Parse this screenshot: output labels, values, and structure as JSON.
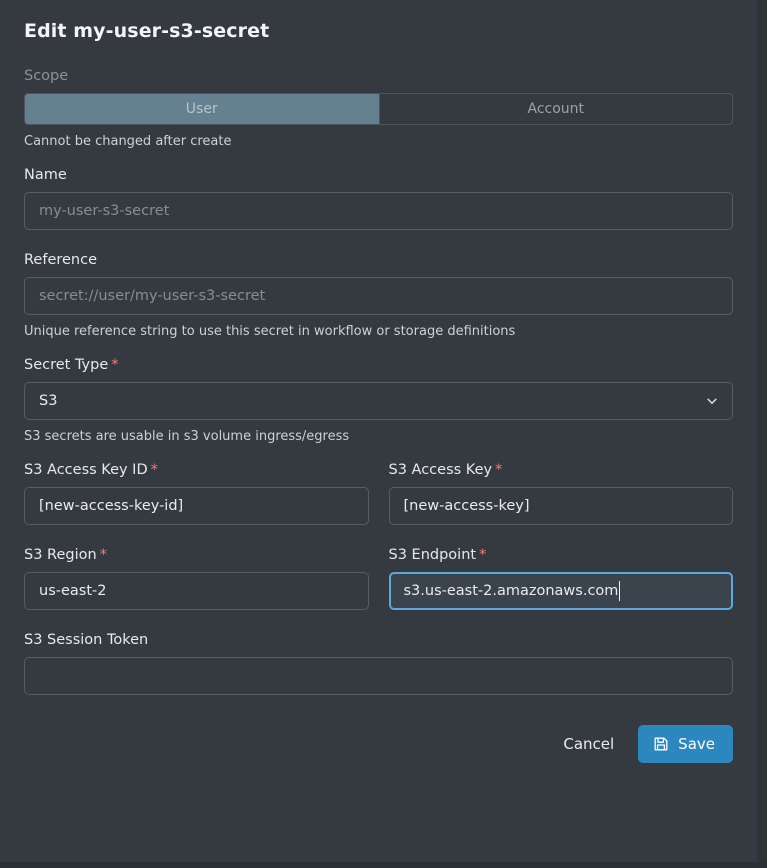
{
  "dialog": {
    "title": "Edit my-user-s3-secret"
  },
  "scope": {
    "label": "Scope",
    "options": [
      {
        "label": "User",
        "selected": true
      },
      {
        "label": "Account",
        "selected": false
      }
    ],
    "help": "Cannot be changed after create"
  },
  "name": {
    "label": "Name",
    "value": "",
    "placeholder": "my-user-s3-secret"
  },
  "reference": {
    "label": "Reference",
    "value": "",
    "placeholder": "secret://user/my-user-s3-secret",
    "help": "Unique reference string to use this secret in workflow or storage definitions"
  },
  "secret_type": {
    "label": "Secret Type",
    "required_marker": "*",
    "value": "S3",
    "help": "S3 secrets are usable in s3 volume ingress/egress",
    "chevron_icon": "chevron-down-icon"
  },
  "s3_access_key_id": {
    "label": "S3 Access Key ID",
    "required_marker": "*",
    "value": "[new-access-key-id]"
  },
  "s3_access_key": {
    "label": "S3 Access Key",
    "required_marker": "*",
    "value": "[new-access-key]"
  },
  "s3_region": {
    "label": "S3 Region",
    "required_marker": "*",
    "value": "us-east-2"
  },
  "s3_endpoint": {
    "label": "S3 Endpoint",
    "required_marker": "*",
    "value": "s3.us-east-2.amazonaws.com",
    "focused": true
  },
  "s3_session_token": {
    "label": "S3 Session Token",
    "value": "",
    "placeholder": ""
  },
  "footer": {
    "cancel_label": "Cancel",
    "save_label": "Save",
    "save_icon": "save-floppy-icon"
  },
  "colors": {
    "background": "#343a40",
    "accent_blue": "#2b87bd",
    "focus_border": "#5aa9e0",
    "required_red": "#e8827c",
    "segment_active": "#65808f"
  }
}
